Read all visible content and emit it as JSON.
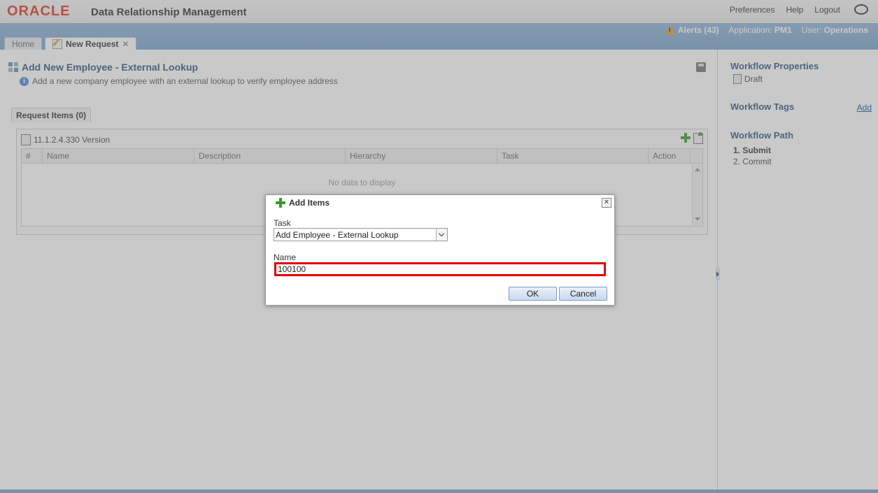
{
  "brand": {
    "logo": "ORACLE",
    "app_name": "Data Relationship Management"
  },
  "top_links": {
    "preferences": "Preferences",
    "help": "Help",
    "logout": "Logout"
  },
  "status": {
    "alerts": "Alerts (43)",
    "application_label": "Application:",
    "application_value": "PM1",
    "user_label": "User:",
    "user_value": "Operations"
  },
  "tabs": [
    {
      "label": "Home"
    },
    {
      "label": "New Request",
      "close": "✕"
    }
  ],
  "page": {
    "title": "Add New Employee - External Lookup",
    "description": "Add a new company employee with an external lookup to verify employee address",
    "request_items_tab": "Request Items (0)",
    "version": "11.1.2.4.330 Version"
  },
  "table": {
    "columns": [
      "#",
      "Name",
      "Description",
      "Hierarchy",
      "Task",
      "Action"
    ],
    "empty_message": "No data to display"
  },
  "side": {
    "properties_title": "Workflow Properties",
    "properties_value": "Draft",
    "tags_title": "Workflow Tags",
    "tags_add": "Add",
    "path_title": "Workflow Path",
    "path_steps": [
      "1. Submit",
      "2. Commit"
    ]
  },
  "dialog": {
    "title": "Add Items",
    "task_label": "Task",
    "task_value": "Add Employee - External Lookup",
    "name_label": "Name",
    "name_value": "100100",
    "ok": "OK",
    "cancel": "Cancel",
    "close": "✕"
  },
  "colors": {
    "brand_red": "#e03a1e",
    "band_blue": "#7aa3cc",
    "heading_blue": "#305880",
    "highlight_red": "#e00000"
  }
}
